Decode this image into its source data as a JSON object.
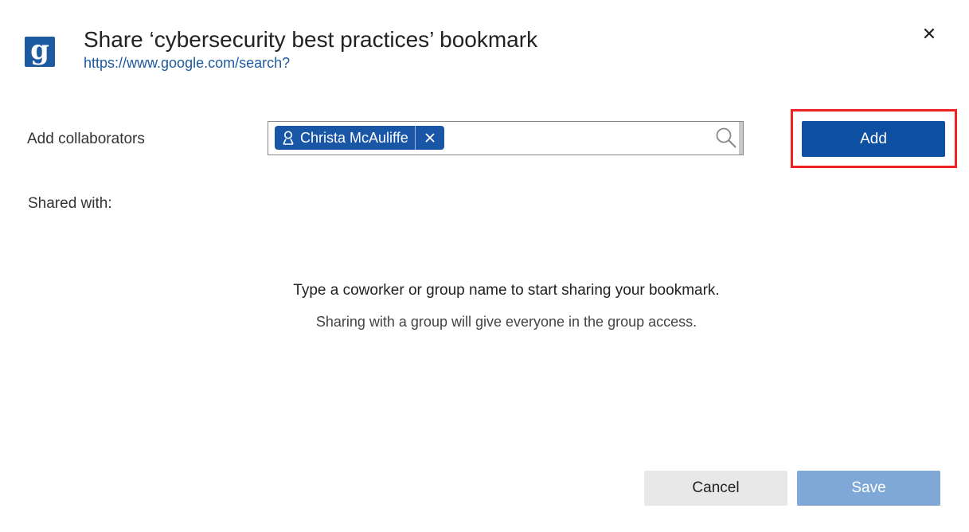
{
  "dialog": {
    "logo_letter": "g",
    "title": "Share ‘cybersecurity best practices’ bookmark",
    "url": "https://www.google.com/search?"
  },
  "collaborators": {
    "label": "Add collaborators",
    "chips": [
      {
        "name": "Christa McAuliffe"
      }
    ],
    "input_value": "",
    "add_label": "Add"
  },
  "shared": {
    "label": "Shared with:",
    "empty_primary": "Type a coworker or group name to start sharing your bookmark.",
    "empty_secondary": "Sharing with a group will give everyone in the group access."
  },
  "footer": {
    "cancel_label": "Cancel",
    "save_label": "Save"
  },
  "colors": {
    "primary": "#0d4fa0",
    "disabled": "#7fa8d6",
    "highlight": "#f0231e"
  }
}
